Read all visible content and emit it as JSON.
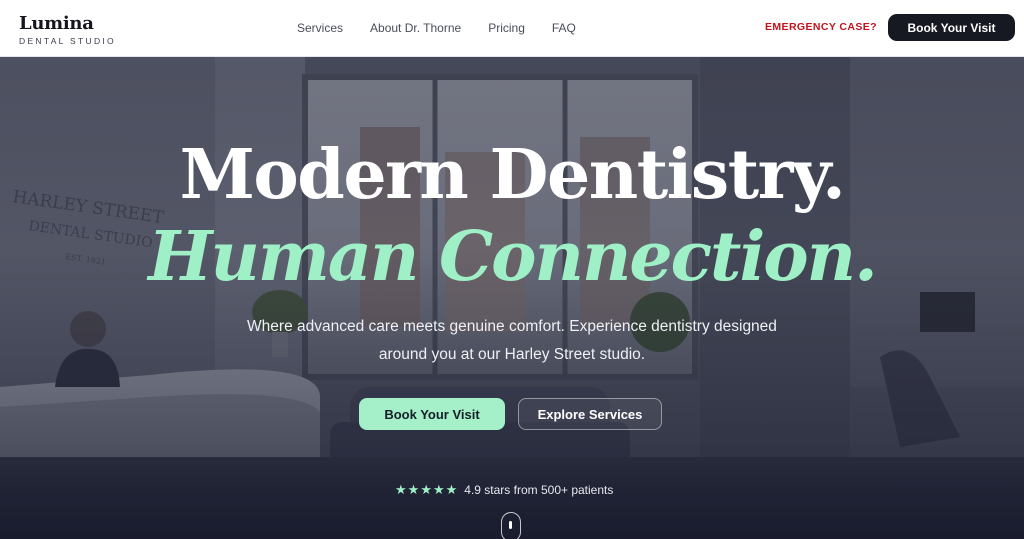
{
  "brand": {
    "name": "Lumina",
    "subtitle": "DENTAL STUDIO"
  },
  "nav": {
    "items": [
      {
        "label": "Services"
      },
      {
        "label": "About Dr. Thorne"
      },
      {
        "label": "Pricing"
      },
      {
        "label": "FAQ"
      }
    ],
    "emergency_label": "EMERGENCY CASE?",
    "cta_label": "Book Your Visit"
  },
  "hero": {
    "headline_line1": "Modern Dentistry.",
    "headline_line2": "Human Connection.",
    "subtitle": "Where advanced care meets genuine comfort. Experience dentistry designed around you at our Harley Street studio.",
    "primary_cta": "Book Your Visit",
    "secondary_cta": "Explore Services",
    "rating": {
      "stars": 5,
      "text": "4.9 stars from 500+ patients"
    },
    "background_sign": [
      "HARLEY STREET",
      "DENTAL STUDIO",
      "EST. 1921"
    ]
  },
  "colors": {
    "accent": "#9ff0c6",
    "header_cta_bg": "#161822",
    "emergency": "#c3141e"
  }
}
